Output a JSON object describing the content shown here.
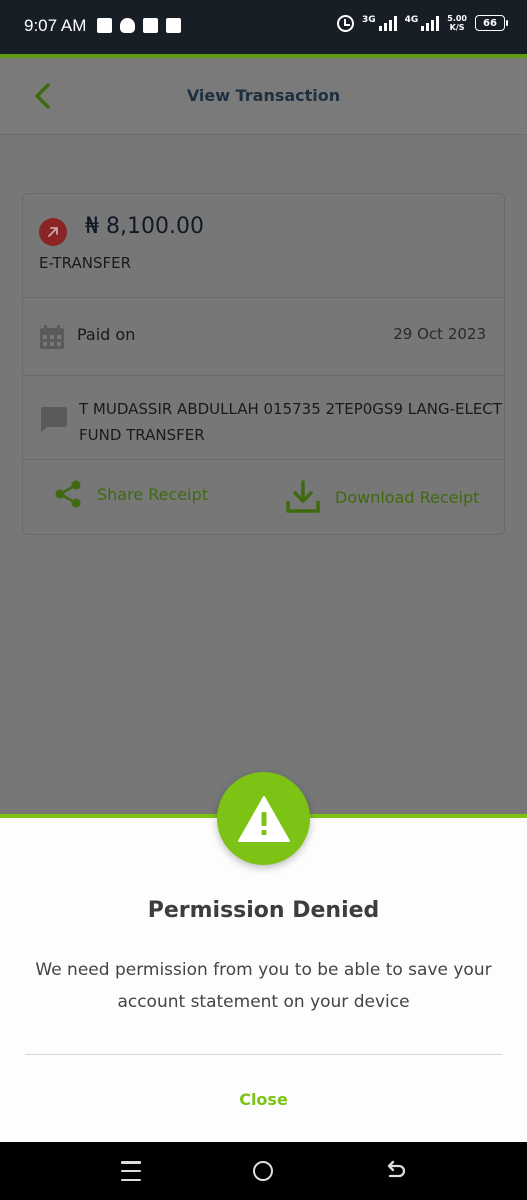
{
  "status_bar": {
    "time": "9:07 AM",
    "network1": "3G",
    "network2": "4G",
    "speed_value": "5.00",
    "speed_unit": "K/S",
    "battery": "66"
  },
  "header": {
    "title": "View Transaction"
  },
  "transaction": {
    "amount": "₦ 8,100.00",
    "type": "E-TRANSFER",
    "paid_on_label": "Paid on",
    "paid_on_date": "29 Oct 2023",
    "narration_line1": "T MUDASSIR ABDULLAH 015735 2TEP0GS9 LANG-ELECT",
    "narration_line2": "FUND TRANSFER",
    "share_label": "Share Receipt",
    "download_label": "Download Receipt"
  },
  "dialog": {
    "title": "Permission Denied",
    "message": "We need permission from you to be able to save your account statement on your device",
    "close_label": "Close"
  },
  "colors": {
    "accent": "#7dc315",
    "header_text": "#1e3040",
    "status_bar": "#171e26"
  }
}
